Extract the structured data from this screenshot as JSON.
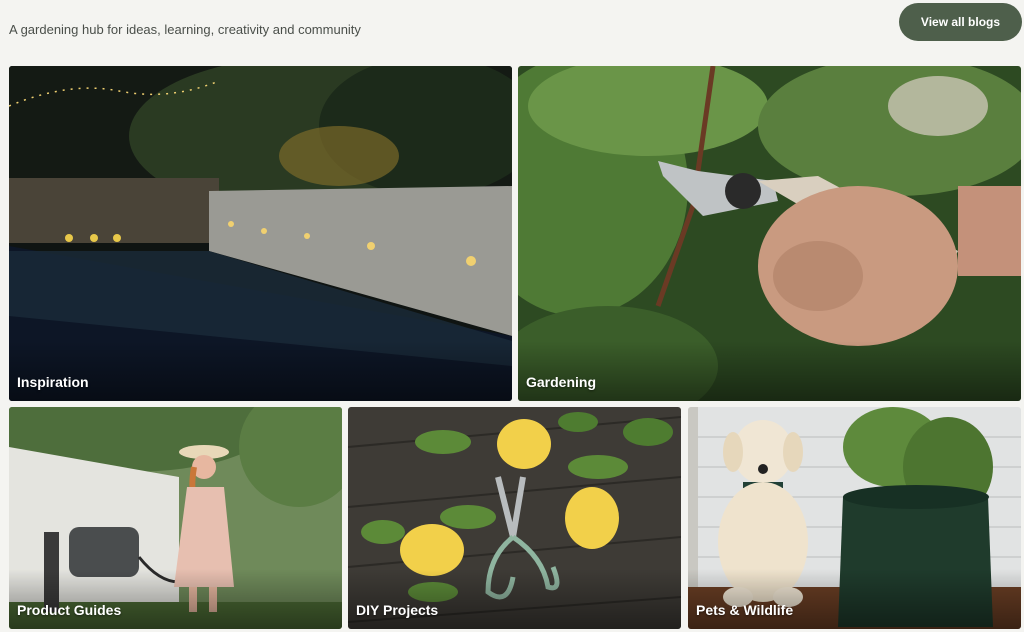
{
  "header": {
    "tagline": "A gardening hub for ideas, learning, creativity and community",
    "view_all_label": "View all blogs"
  },
  "tiles": [
    {
      "label": "Inspiration"
    },
    {
      "label": "Gardening"
    },
    {
      "label": "Product Guides"
    },
    {
      "label": "DIY Projects"
    },
    {
      "label": "Pets & Wildlife"
    }
  ],
  "colors": {
    "accent": "#4e5f4b",
    "background": "#f4f4f1"
  }
}
